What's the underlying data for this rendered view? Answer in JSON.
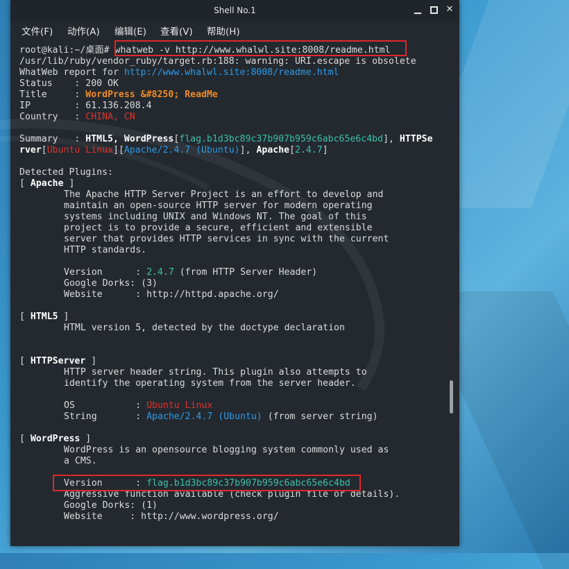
{
  "window": {
    "title": "Shell No.1",
    "buttons": {
      "minimize": "▁",
      "close": "✕"
    }
  },
  "menu": [
    "文件(F)",
    "动作(A)",
    "编辑(E)",
    "查看(V)",
    "帮助(H)"
  ],
  "terminal": {
    "prompt": "root@kali:~/桌面# ",
    "command": "whatweb -v http://www.whalwl.site:8008/readme.html",
    "warning": "/usr/lib/ruby/vendor_ruby/target.rb:188: warning: URI.escape is obsolete",
    "report_prefix": "WhatWeb report for ",
    "report_url": "http://www.whalwl.site:8008/readme.html",
    "status_label": "Status    : ",
    "status_value": "200 OK",
    "title_label": "Title     : ",
    "title_value": "WordPress &#8250; ReadMe",
    "ip_label": "IP        : ",
    "ip_value": "61.136.208.4",
    "country_label": "Country   : ",
    "country_value": "CHINA, CN",
    "summary_label": "Summary   : ",
    "summary": {
      "html5": "HTML5",
      "comma1": ", ",
      "wordpress": "WordPress",
      "flag": "flag.b1d3bc89c37b907b959c6abc65e6c4bd",
      "httpse": "HTTPSe",
      "rver": "rver",
      "ubuntu": "Ubuntu Linux",
      "apache_ubuntu": "Apache/2.4.7 (Ubuntu)",
      "apache": "Apache",
      "apache_ver": "2.4.7"
    },
    "detected": "Detected Plugins:",
    "apache_header": "Apache",
    "apache_desc": [
      "The Apache HTTP Server Project is an effort to develop and",
      "maintain an open-source HTTP server for modern operating",
      "systems including UNIX and Windows NT. The goal of this",
      "project is to provide a secure, efficient and extensible",
      "server that provides HTTP services in sync with the current",
      "HTTP standards."
    ],
    "apache_version_label": "Version      : ",
    "apache_version_value": "2.4.7",
    "apache_version_note": " (from HTTP Server Header)",
    "apache_dorks": "Google Dorks: (3)",
    "apache_website": "Website      : http://httpd.apache.org/",
    "html5_header": "HTML5",
    "html5_desc": "HTML version 5, detected by the doctype declaration",
    "httpserver_header": "HTTPServer",
    "httpserver_desc": [
      "HTTP server header string. This plugin also attempts to",
      "identify the operating system from the server header."
    ],
    "os_label": "OS           : ",
    "os_value": "Ubuntu Linux",
    "string_label": "String       : ",
    "string_value": "Apache/2.4.7 (Ubuntu)",
    "string_note": " (from server string)",
    "wordpress_header": "WordPress",
    "wordpress_desc": [
      "WordPress is an opensource blogging system commonly used as",
      "a CMS."
    ],
    "wp_version_label": "Version      : ",
    "wp_version_value": "flag.b1d3bc89c37b907b959c6abc65e6c4bd",
    "wp_aggressive": "Aggressive function available (check plugin file or details).",
    "wp_dorks": "Google Dorks: (1)",
    "wp_website": "Website     : http://www.wordpress.org/"
  },
  "colors": {
    "terminal_bg": "#23292f",
    "highlight_box": "#e0282c",
    "url_blue": "#2f9ae6",
    "title_orange": "#f08a24",
    "country_red": "#e0322c",
    "flag_cyan": "#3cc0a8"
  }
}
